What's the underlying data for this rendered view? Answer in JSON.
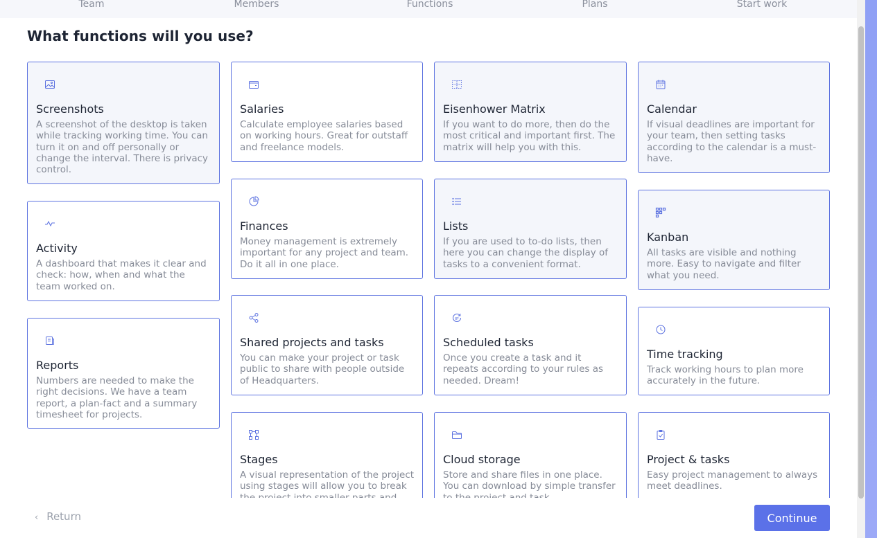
{
  "steps": [
    "Team",
    "Members",
    "Functions",
    "Plans",
    "Start work"
  ],
  "heading": "What functions will you use?",
  "accent_color": "#5b71e0",
  "cards": [
    {
      "title": "Screenshots",
      "icon": "image-icon",
      "selected": true,
      "desc": "A screenshot of the desktop is taken while tracking working time. You can turn it on and off personally or change the interval. There is privacy control."
    },
    {
      "title": "Activity",
      "icon": "activity-icon",
      "selected": false,
      "desc": "A dashboard that makes it clear and check: how, when and what the team worked on."
    },
    {
      "title": "Reports",
      "icon": "report-icon",
      "selected": false,
      "desc": "Numbers are needed to make the right decisions. We have a team report, a plan-fact and a summary timesheet for projects."
    },
    {
      "title": "Salaries",
      "icon": "wallet-icon",
      "selected": false,
      "desc": "Calculate employee salaries based on working hours. Great for outstaff and freelance models."
    },
    {
      "title": "Finances",
      "icon": "pie-chart-icon",
      "selected": false,
      "desc": "Money management is extremely important for any project and team. Do it all in one place."
    },
    {
      "title": "Shared projects and tasks",
      "icon": "share-icon",
      "selected": false,
      "desc": "You can make your project or task public to share with people outside of Headquarters."
    },
    {
      "title": "Stages",
      "icon": "stages-icon",
      "selected": false,
      "desc": "A visual representation of the project using stages will allow you to break the project into smaller parts and"
    },
    {
      "title": "Eisenhower Matrix",
      "icon": "matrix-icon",
      "selected": true,
      "desc": "If you want to do more, then do the most critical and important first. The matrix will help you with this."
    },
    {
      "title": "Lists",
      "icon": "list-icon",
      "selected": true,
      "desc": "If you are used to to-do lists, then here you can change the display of tasks to a convenient format."
    },
    {
      "title": "Scheduled tasks",
      "icon": "repeat-icon",
      "selected": false,
      "desc": "Once you create a task and it repeats according to your rules as needed. Dream!"
    },
    {
      "title": "Cloud storage",
      "icon": "folder-icon",
      "selected": false,
      "desc": "Store and share files in one place. You can download by simple transfer to the project and task"
    },
    {
      "title": "Calendar",
      "icon": "calendar-icon",
      "selected": true,
      "desc": "If visual deadlines are important for your team, then setting tasks according to the calendar is a must-have."
    },
    {
      "title": "Kanban",
      "icon": "kanban-icon",
      "selected": true,
      "desc": "All tasks are visible and nothing more. Easy to navigate and filter what you need."
    },
    {
      "title": "Time tracking",
      "icon": "clock-icon",
      "selected": false,
      "desc": "Track working hours to plan more accurately in the future."
    },
    {
      "title": "Project & tasks",
      "icon": "clipboard-icon",
      "selected": false,
      "desc": "Easy project management to always meet deadlines."
    }
  ],
  "footer": {
    "return_label": "Return",
    "continue_label": "Continue"
  }
}
